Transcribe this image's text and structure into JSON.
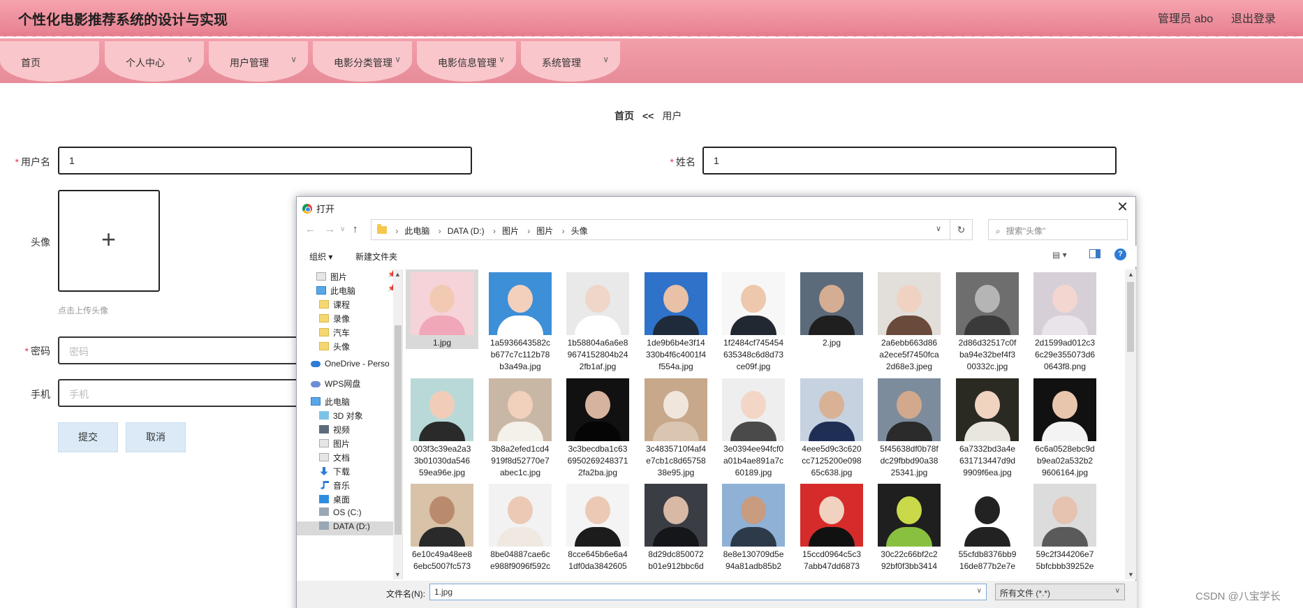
{
  "header": {
    "title": "个性化电影推荐系统的设计与实现",
    "admin_label": "管理员 abo",
    "logout_label": "退出登录",
    "accent": "#e77f8f"
  },
  "nav": [
    {
      "label": "首页",
      "chevron": ""
    },
    {
      "label": "个人中心",
      "chevron": "∨"
    },
    {
      "label": "用户管理",
      "chevron": "∨"
    },
    {
      "label": "电影分类管理",
      "chevron": "∨"
    },
    {
      "label": "电影信息管理",
      "chevron": "∨"
    },
    {
      "label": "系统管理",
      "chevron": "∨"
    }
  ],
  "breadcrumb": {
    "home": "首页",
    "sep": "<<",
    "current": "用户"
  },
  "form": {
    "username_label": "用户名",
    "username_value": "1",
    "name_label": "姓名",
    "name_value": "1",
    "avatar_label": "头像",
    "avatar_hint": "点击上传头像",
    "password_label": "密码",
    "password_placeholder": "密码",
    "phone_label": "手机",
    "phone_placeholder": "手机",
    "required_mark": "*",
    "submit_label": "提交",
    "cancel_label": "取消"
  },
  "dialog": {
    "title": "打开",
    "close_glyph": "✕",
    "path": [
      "此电脑",
      "DATA (D:)",
      "图片",
      "图片",
      "头像"
    ],
    "search_placeholder": "搜索\"头像\"",
    "organize_label": "组织 ▾",
    "new_folder_label": "新建文件夹",
    "help_glyph": "?",
    "sidebar": [
      {
        "label": "图片",
        "icon": "picture-icon",
        "pinned": true
      },
      {
        "label": "此电脑",
        "icon": "computer-icon",
        "pinned": true
      },
      {
        "label": "课程",
        "icon": "folder-icon"
      },
      {
        "label": "录像",
        "icon": "folder-icon"
      },
      {
        "label": "汽车",
        "icon": "folder-icon"
      },
      {
        "label": "头像",
        "icon": "folder-icon"
      },
      {
        "label": "OneDrive - Perso",
        "icon": "cloud-icon"
      },
      {
        "label": "WPS网盘",
        "icon": "wps-cloud-icon"
      },
      {
        "label": "此电脑",
        "icon": "computer-icon"
      },
      {
        "label": "3D 对象",
        "icon": "cube-icon"
      },
      {
        "label": "视频",
        "icon": "video-icon"
      },
      {
        "label": "图片",
        "icon": "picture-icon"
      },
      {
        "label": "文档",
        "icon": "document-icon"
      },
      {
        "label": "下载",
        "icon": "download-icon"
      },
      {
        "label": "音乐",
        "icon": "music-icon"
      },
      {
        "label": "桌面",
        "icon": "desktop-icon"
      },
      {
        "label": "OS (C:)",
        "icon": "drive-icon"
      },
      {
        "label": "DATA (D:)",
        "icon": "drive-icon"
      }
    ],
    "files": [
      {
        "name": "1.jpg",
        "lines": [
          "1.jpg"
        ],
        "bg": "#f6d3d8",
        "skin": "#f2c9b3",
        "cloth": "#f0a8b8"
      },
      {
        "name": "1a5936643582cb677c7c112b78b3a49a.jpg",
        "lines": [
          "1a5936643582c",
          "b677c7c112b78",
          "b3a49a.jpg"
        ],
        "bg": "#3d8fd8",
        "skin": "#f3d0bc",
        "cloth": "#ffffff"
      },
      {
        "name": "1b58804a6a6e89674152804b242fb1af.jpg",
        "lines": [
          "1b58804a6a6e8",
          "9674152804b24",
          "2fb1af.jpg"
        ],
        "bg": "#e9e9ea",
        "skin": "#efd6c9",
        "cloth": "#ffffff"
      },
      {
        "name": "1de9b6b4e3f14330b4f6c4001f4f554a.jpg",
        "lines": [
          "1de9b6b4e3f14",
          "330b4f6c4001f4",
          "f554a.jpg"
        ],
        "bg": "#2f72c9",
        "skin": "#e8c1a6",
        "cloth": "#1f2a3a"
      },
      {
        "name": "1f2484cf745454635348c6d8d73ce09f.jpg",
        "lines": [
          "1f2484cf745454",
          "635348c6d8d73",
          "ce09f.jpg"
        ],
        "bg": "#f7f7f7",
        "skin": "#eec8ad",
        "cloth": "#222831"
      },
      {
        "name": "2.jpg",
        "lines": [
          "2.jpg"
        ],
        "bg": "#5c6b7b",
        "skin": "#d5ad92",
        "cloth": "#1f1f1f"
      },
      {
        "name": "2a6ebb663d86a2ece5f7450fca2d68e3.jpeg",
        "lines": [
          "2a6ebb663d86",
          "a2ece5f7450fca",
          "2d68e3.jpeg"
        ],
        "bg": "#e2ded9",
        "skin": "#f0d2c3",
        "cloth": "#6a4a3a"
      },
      {
        "name": "2d86d32517c0fba94e32bef4f300332c.jpg",
        "lines": [
          "2d86d32517c0f",
          "ba94e32bef4f3",
          "00332c.jpg"
        ],
        "bg": "#6e6e6e",
        "skin": "#b5b5b5",
        "cloth": "#3a3a3a"
      },
      {
        "name": "2d1599ad012c36c29e355073d60643f8.png",
        "lines": [
          "2d1599ad012c3",
          "6c29e355073d6",
          "0643f8.png"
        ],
        "bg": "#d7cfd8",
        "skin": "#f2d6cf",
        "cloth": "#e9e3ea"
      },
      {
        "name": "003f3c39ea2a33b01030da54659ea96e.jpg",
        "lines": [
          "003f3c39ea2a3",
          "3b01030da546",
          "59ea96e.jpg"
        ],
        "bg": "#b8d9d8",
        "skin": "#f1cdb9",
        "cloth": "#2a2a2a"
      },
      {
        "name": "3b8a2efed1cd4919f8d52770e7abec1c.jpg",
        "lines": [
          "3b8a2efed1cd4",
          "919f8d52770e7",
          "abec1c.jpg"
        ],
        "bg": "#c9b7a5",
        "skin": "#f1d0bc",
        "cloth": "#f4f0ea"
      },
      {
        "name": "3c3becdba1c636950269248371 2fa2ba.jpg",
        "lines": [
          "3c3becdba1c63",
          "6950269248371",
          "2fa2ba.jpg"
        ],
        "bg": "#111111",
        "skin": "#d6b39e",
        "cloth": "#050505"
      },
      {
        "name": "3c4835710f4af4e7cb1c8d6575838e95.jpg",
        "lines": [
          "3c4835710f4af4",
          "e7cb1c8d65758",
          "38e95.jpg"
        ],
        "bg": "#c7a88b",
        "skin": "#f1e6dc",
        "cloth": "#d9c5b0"
      },
      {
        "name": "3e0394ee94fcf0a01b4ae891a7c60189.jpg",
        "lines": [
          "3e0394ee94fcf0",
          "a01b4ae891a7c",
          "60189.jpg"
        ],
        "bg": "#eeeeee",
        "skin": "#f3d6c6",
        "cloth": "#4a4a4a"
      },
      {
        "name": "4eee5d9c3c620cc7125200e09865c638.jpg",
        "lines": [
          "4eee5d9c3c620",
          "cc7125200e098",
          "65c638.jpg"
        ],
        "bg": "#c6d2e0",
        "skin": "#d9b296",
        "cloth": "#1f2e55"
      },
      {
        "name": "5f45638df0b78fdc29fbbd90a3825341.jpg",
        "lines": [
          "5f45638df0b78f",
          "dc29fbbd90a38",
          "25341.jpg"
        ],
        "bg": "#7d8c9c",
        "skin": "#d2a98c",
        "cloth": "#2b2b2b"
      },
      {
        "name": "6a7332bd3a4e631713447d9d9909f6ea.jpg",
        "lines": [
          "6a7332bd3a4e",
          "631713447d9d",
          "9909f6ea.jpg"
        ],
        "bg": "#2a2a22",
        "skin": "#f0d3c0",
        "cloth": "#e9e6df"
      },
      {
        "name": "6c6a0528ebc9db9ea02a532b29606164.jpg",
        "lines": [
          "6c6a0528ebc9d",
          "b9ea02a532b2",
          "9606164.jpg"
        ],
        "bg": "#111111",
        "skin": "#e8c6ae",
        "cloth": "#f3f3f3"
      },
      {
        "name": "6e10c49a48ee86ebc5007fc573",
        "lines": [
          "6e10c49a48ee8",
          "6ebc5007fc573"
        ],
        "bg": "#d8c2a8",
        "skin": "#b98b6c",
        "cloth": "#2a2a2a"
      },
      {
        "name": "8be04887cae6ce988f9096f592c",
        "lines": [
          "8be04887cae6c",
          "e988f9096f592c"
        ],
        "bg": "#f2f2f2",
        "skin": "#ecc9b5",
        "cloth": "#efe9e1"
      },
      {
        "name": "8cce645b6e6a41df0da3842605",
        "lines": [
          "8cce645b6e6a4",
          "1df0da3842605"
        ],
        "bg": "#f4f4f4",
        "skin": "#ecc9b5",
        "cloth": "#1c1c1c"
      },
      {
        "name": "8d29dc850072b01e912bbc6d",
        "lines": [
          "8d29dc850072",
          "b01e912bbc6d"
        ],
        "bg": "#3b3d45",
        "skin": "#d8b9a5",
        "cloth": "#15161a"
      },
      {
        "name": "8e8e130709d5e94a81adb85b2",
        "lines": [
          "8e8e130709d5e",
          "94a81adb85b2"
        ],
        "bg": "#8fb1d6",
        "skin": "#c99b7f",
        "cloth": "#2d3a4a"
      },
      {
        "name": "15ccd0964c5c37abb47dd6873",
        "lines": [
          "15ccd0964c5c3",
          "7abb47dd6873"
        ],
        "bg": "#d62b2b",
        "skin": "#f1d2c0",
        "cloth": "#111111"
      },
      {
        "name": "30c22c66bf2c292bf0f3bb3414",
        "lines": [
          "30c22c66bf2c2",
          "92bf0f3bb3414"
        ],
        "bg": "#1f1f1f",
        "skin": "#c9d94a",
        "cloth": "#8ac040"
      },
      {
        "name": "55cfdb8376bb916de877b2e7e",
        "lines": [
          "55cfdb8376bb9",
          "16de877b2e7e"
        ],
        "bg": "#ffffff",
        "skin": "#222222",
        "cloth": "#222222"
      },
      {
        "name": "59c2f344206e75bfcbbb39252e",
        "lines": [
          "59c2f344206e7",
          "5bfcbbb39252e"
        ],
        "bg": "#dcdcdc",
        "skin": "#e6c3b0",
        "cloth": "#5a5a5a"
      }
    ],
    "filename_label": "文件名(N):",
    "filename_value": "1.jpg",
    "filetype_value": "所有文件 (*.*)"
  },
  "watermark": "CSDN @八宝学长"
}
